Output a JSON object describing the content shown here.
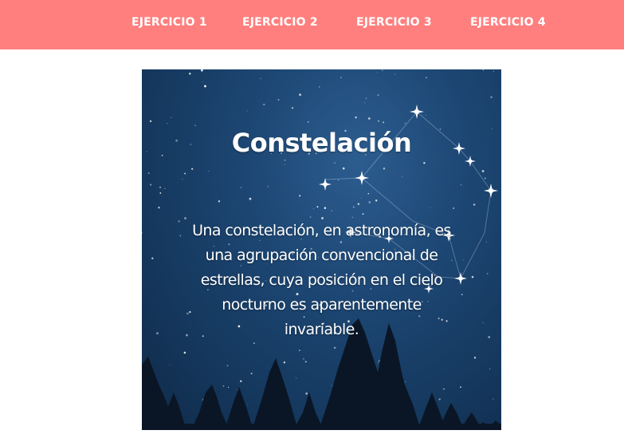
{
  "nav": {
    "items": [
      "EJERCICIO 1",
      "EJERCICIO 2",
      "EJERCICIO 3",
      "EJERCICIO 4"
    ]
  },
  "card": {
    "title": "Constelación",
    "description": "Una constelación, en astronomía, es una agrupación convencional de estrellas, cuya posición en el cielo nocturno es aparentemente invariable."
  },
  "colors": {
    "navbar": "#ff7f7f",
    "sky": "#1d4774",
    "text": "#ffffff"
  }
}
